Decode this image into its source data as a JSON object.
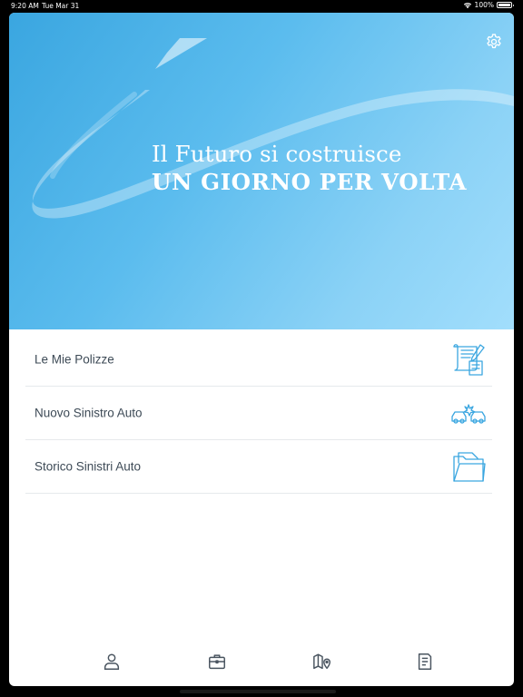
{
  "status_bar": {
    "time": "9:20 AM",
    "date": "Tue Mar 31",
    "battery": "100%",
    "icons": [
      "wifi-icon",
      "battery-icon"
    ]
  },
  "hero": {
    "line1": "Il Futuro si costruisce",
    "line2": "UN GIORNO PER VOLTA",
    "settings_icon": "gear-icon"
  },
  "menu": {
    "items": [
      {
        "label": "Le Mie Polizze",
        "icon": "policy-document-icon"
      },
      {
        "label": "Nuovo Sinistro Auto",
        "icon": "car-crash-icon"
      },
      {
        "label": "Storico Sinistri Auto",
        "icon": "folder-icon"
      }
    ]
  },
  "tab_bar": {
    "tabs": [
      {
        "icon": "person-icon"
      },
      {
        "icon": "briefcase-icon"
      },
      {
        "icon": "map-pin-icon"
      },
      {
        "icon": "document-icon"
      }
    ]
  },
  "colors": {
    "hero_gradient_start": "#3aa6e0",
    "hero_gradient_end": "#a2defc",
    "accent_icon": "#3aa6e0",
    "menu_text": "#3d4a56",
    "tab_icon": "#4a5560"
  }
}
